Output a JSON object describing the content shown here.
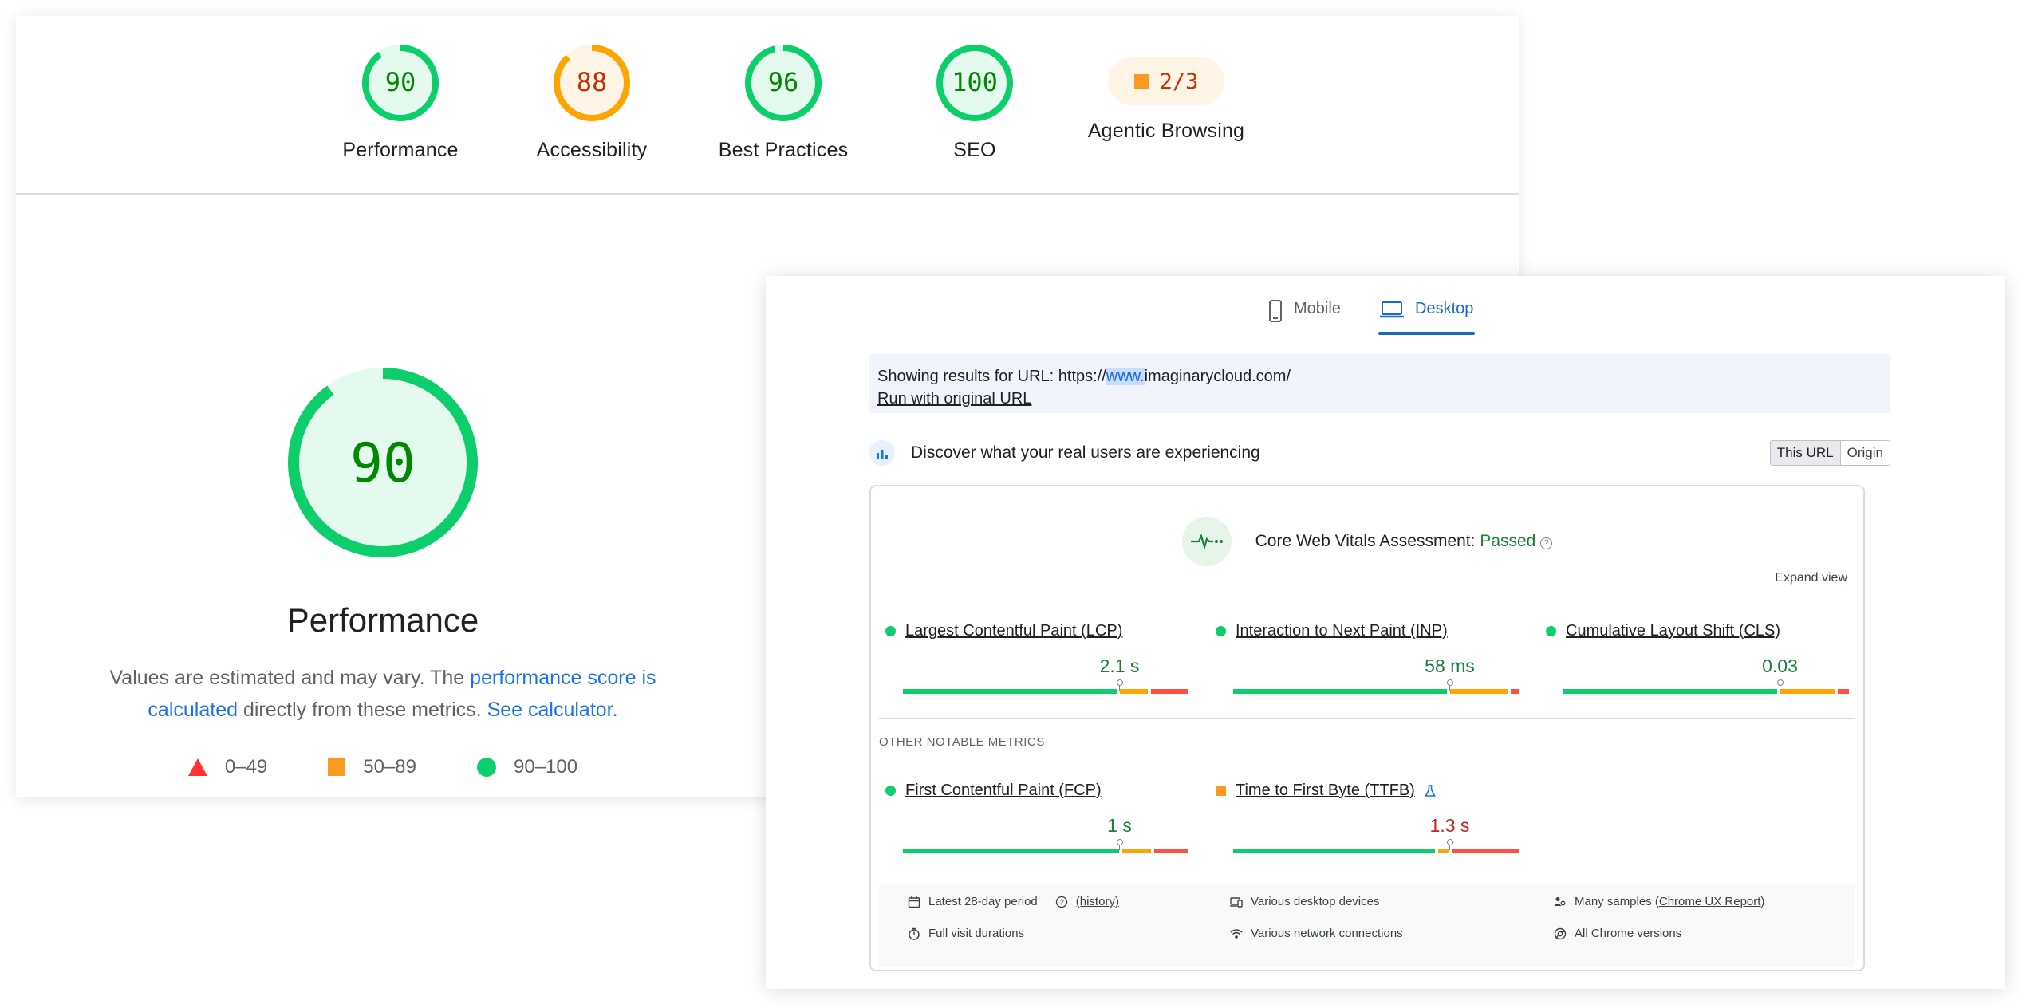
{
  "lighthouse": {
    "categories": [
      {
        "label": "Performance",
        "score": "90",
        "value": 90,
        "color": "#0cce6b",
        "text_color": "#008800",
        "fill": "#e5faef"
      },
      {
        "label": "Accessibility",
        "score": "88",
        "value": 88,
        "color": "#ffa400",
        "text_color": "#c33300",
        "fill": "#fff4e5"
      },
      {
        "label": "Best Practices",
        "score": "96",
        "value": 96,
        "color": "#0cce6b",
        "text_color": "#008800",
        "fill": "#e5faef"
      },
      {
        "label": "SEO",
        "score": "100",
        "value": 100,
        "color": "#0cce6b",
        "text_color": "#008800",
        "fill": "#e5faef"
      }
    ],
    "agentic": {
      "label": "Agentic Browsing",
      "score": "2/3",
      "color": "#fa9a1e"
    },
    "performance": {
      "score": "90",
      "value": 90,
      "title": "Performance",
      "desc_prefix": "Values are estimated and may vary. The ",
      "desc_link1": "performance score is calculated",
      "desc_middle": " directly from these metrics. ",
      "desc_link2": "See calculator."
    },
    "legend": [
      {
        "shape": "triangle",
        "range": "0–49",
        "color": "#ff3333"
      },
      {
        "shape": "square",
        "range": "50–89",
        "color": "#fa9a1e"
      },
      {
        "shape": "circle",
        "range": "90–100",
        "color": "#0cce6b"
      }
    ]
  },
  "crux": {
    "tabs": [
      {
        "label": "Mobile",
        "icon": "phone-icon",
        "active": false
      },
      {
        "label": "Desktop",
        "icon": "laptop-icon",
        "active": true
      }
    ],
    "url_banner": {
      "prefix": "Showing results for URL: https://",
      "highlight": "www.",
      "suffix": "imaginarycloud.com/",
      "run_link": "Run with original URL"
    },
    "discover": {
      "text": "Discover what your real users are experiencing",
      "scope": [
        "This URL",
        "Origin"
      ],
      "scope_selected": "This URL"
    },
    "assessment": {
      "label": "Core Web Vitals Assessment: ",
      "status": "Passed",
      "help": "?",
      "expand": "Expand view"
    },
    "core_metrics": [
      {
        "name": "Largest Contentful Paint (LCP)",
        "value": "2.1 s",
        "rating": "good",
        "distribution": [
          0.75,
          0.11,
          0.14
        ],
        "p75_position": 0.75
      },
      {
        "name": "Interaction to Next Paint (INP)",
        "value": "58 ms",
        "rating": "good",
        "distribution": [
          0.75,
          0.21,
          0.04
        ],
        "p75_position": 0.75
      },
      {
        "name": "Cumulative Layout Shift (CLS)",
        "value": "0.03",
        "rating": "good",
        "distribution": [
          0.75,
          0.2,
          0.05
        ],
        "p75_position": 0.75
      }
    ],
    "other_label": "OTHER NOTABLE METRICS",
    "other_metrics": [
      {
        "name": "First Contentful Paint (FCP)",
        "value": "1 s",
        "rating": "good",
        "distribution": [
          0.76,
          0.11,
          0.13
        ],
        "p75_position": 0.75
      },
      {
        "name": "Time to First Byte (TTFB)",
        "value": "1.3 s",
        "rating": "average",
        "distribution": [
          0.71,
          0.05,
          0.24
        ],
        "p75_position": 0.75,
        "experimental": true
      }
    ],
    "footer": {
      "period": "Latest 28-day period",
      "history": "(history)",
      "durations": "Full visit durations",
      "devices": "Various desktop devices",
      "connections": "Various network connections",
      "samples_prefix": "Many samples (",
      "samples_link": "Chrome UX Report",
      "samples_suffix": ")",
      "versions": "All Chrome versions"
    },
    "colors": {
      "good": "#0cce6b",
      "average": "#ffa400",
      "poor": "#ff4e42",
      "accent": "#1967d2"
    }
  }
}
